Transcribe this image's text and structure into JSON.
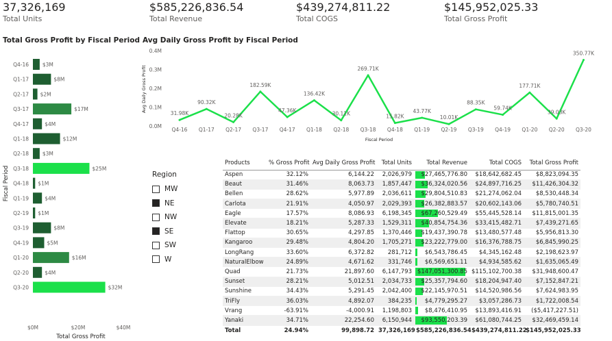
{
  "kpis": [
    {
      "value": "37,326,169",
      "label": "Total Units"
    },
    {
      "value": "$585,226,836.54",
      "label": "Total Revenue"
    },
    {
      "value": "$439,274,811.22",
      "label": "Total COGS"
    },
    {
      "value": "$145,952,025.33",
      "label": "Total Gross Profit"
    }
  ],
  "bar_chart_title": "Total Gross Profit by Fiscal Period",
  "line_chart_title": "Avg Daily Gross Profit by Fiscal Period",
  "colors": {
    "bar_dark": "#1e5e31",
    "bar_mid": "#2d8a44",
    "bar_bright": "#1be04a",
    "line": "#1be04a",
    "checked": "#252423"
  },
  "chart_data": [
    {
      "type": "bar",
      "orientation": "horizontal",
      "categories": [
        "Q4-16",
        "Q1-17",
        "Q2-17",
        "Q3-17",
        "Q4-17",
        "Q1-18",
        "Q2-18",
        "Q3-18",
        "Q4-18",
        "Q1-19",
        "Q2-19",
        "Q3-19",
        "Q4-19",
        "Q1-20",
        "Q2-20",
        "Q3-20"
      ],
      "values": [
        3,
        8,
        2,
        17,
        4,
        12,
        3,
        25,
        1,
        4,
        1,
        8,
        5,
        16,
        4,
        32
      ],
      "data_labels": [
        "$3M",
        "$8M",
        "$2M",
        "$17M",
        "$4M",
        "$12M",
        "$3M",
        "$25M",
        "$1M",
        "$4M",
        "$1M",
        "$8M",
        "$5M",
        "$16M",
        "$4M",
        "$32M"
      ],
      "xlabel": "Total Gross Profit",
      "ylabel": "Fiscal Period",
      "xlim": [
        0,
        40
      ],
      "xticks": [
        "$0M",
        "$20M",
        "$40M"
      ]
    },
    {
      "type": "line",
      "x": [
        "Q4-16",
        "Q1-17",
        "Q2-17",
        "Q3-17",
        "Q4-17",
        "Q1-18",
        "Q2-18",
        "Q3-18",
        "Q4-18",
        "Q1-19",
        "Q2-19",
        "Q3-19",
        "Q4-19",
        "Q1-20",
        "Q2-20",
        "Q3-20"
      ],
      "values": [
        31.98,
        90.32,
        20.28,
        182.59,
        47.36,
        136.42,
        30.11,
        269.71,
        15.82,
        43.77,
        10.01,
        88.35,
        59.74,
        177.71,
        39.03,
        350.77
      ],
      "data_labels": [
        "31.98K",
        "90.32K",
        "20.28K",
        "182.59K",
        "47.36K",
        "136.42K",
        "30.11K",
        "269.71K",
        "15.82K",
        "43.77K",
        "10.01K",
        "88.35K",
        "59.74K",
        "177.71K",
        "39.03K",
        "350.77K"
      ],
      "xlabel": "Fiscal Period",
      "ylabel": "Avg Daily Gross Profit",
      "ylim": [
        0,
        400
      ],
      "yticks": [
        "0.0M",
        "0.1M",
        "0.2M",
        "0.3M",
        "0.4M"
      ]
    }
  ],
  "slicer": {
    "title": "Region",
    "items": [
      {
        "label": "MW",
        "checked": false
      },
      {
        "label": "NE",
        "checked": true
      },
      {
        "label": "NW",
        "checked": false
      },
      {
        "label": "SE",
        "checked": true
      },
      {
        "label": "SW",
        "checked": false
      },
      {
        "label": "W",
        "checked": false
      }
    ]
  },
  "table": {
    "headers": [
      "Products",
      "% Gross Profit",
      "Avg Daily Gross Profit",
      "Total Units",
      "Total Revenue",
      "Total COGS",
      "Total Gross Profit"
    ],
    "rows": [
      {
        "cells": [
          "Aspen",
          "32.12%",
          "6,144.22",
          "2,026,979",
          "$27,465,776.80",
          "$18,642,682.45",
          "$8,823,094.35"
        ],
        "revenue": 27.47
      },
      {
        "cells": [
          "Beaut",
          "31.46%",
          "8,063.73",
          "1,857,447",
          "$36,324,020.56",
          "$24,897,716.25",
          "$11,426,304.32"
        ],
        "revenue": 36.32
      },
      {
        "cells": [
          "Bellen",
          "28.62%",
          "5,977.89",
          "2,036,611",
          "$29,804,510.83",
          "$21,274,062.04",
          "$8,530,448.34"
        ],
        "revenue": 29.8
      },
      {
        "cells": [
          "Carlota",
          "21.91%",
          "4,050.97",
          "2,029,393",
          "$26,382,883.57",
          "$20,602,143.06",
          "$5,780,740.51"
        ],
        "revenue": 26.38
      },
      {
        "cells": [
          "Eagle",
          "17.57%",
          "8,086.93",
          "6,198,345",
          "$67,260,529.49",
          "$55,445,528.14",
          "$11,815,001.35"
        ],
        "revenue": 67.26
      },
      {
        "cells": [
          "Elevate",
          "18.21%",
          "5,287.33",
          "1,529,311",
          "$40,854,754.36",
          "$33,415,482.71",
          "$7,439,271.65"
        ],
        "revenue": 40.85
      },
      {
        "cells": [
          "Flattop",
          "30.65%",
          "4,297.85",
          "1,370,446",
          "$19,437,390.78",
          "$13,480,577.48",
          "$5,956,813.30"
        ],
        "revenue": 19.44
      },
      {
        "cells": [
          "Kangaroo",
          "29.48%",
          "4,804.20",
          "1,705,271",
          "$23,222,779.00",
          "$16,376,788.75",
          "$6,845,990.25"
        ],
        "revenue": 23.22
      },
      {
        "cells": [
          "LongRang",
          "33.60%",
          "6,372.82",
          "281,712",
          "$6,543,786.45",
          "$4,345,162.48",
          "$2,198,623.97"
        ],
        "revenue": 6.54
      },
      {
        "cells": [
          "NaturalElbow",
          "24.89%",
          "4,671.62",
          "331,746",
          "$6,569,651.11",
          "$4,934,585.62",
          "$1,635,065.49"
        ],
        "revenue": 6.57
      },
      {
        "cells": [
          "Quad",
          "21.73%",
          "21,897.60",
          "6,147,793",
          "$147,051,300.85",
          "$115,102,700.38",
          "$31,948,600.47"
        ],
        "revenue": 147.05
      },
      {
        "cells": [
          "Sunset",
          "28.21%",
          "5,012.51",
          "2,034,733",
          "$25,357,794.60",
          "$18,204,947.40",
          "$7,152,847.21"
        ],
        "revenue": 25.36
      },
      {
        "cells": [
          "Sunshine",
          "34.43%",
          "5,291.45",
          "2,042,400",
          "$22,145,970.51",
          "$14,520,986.56",
          "$7,624,983.95"
        ],
        "revenue": 22.15
      },
      {
        "cells": [
          "TriFly",
          "36.03%",
          "4,892.07",
          "384,235",
          "$4,779,295.27",
          "$3,057,286.73",
          "$1,722,008.54"
        ],
        "revenue": 4.78
      },
      {
        "cells": [
          "Vrang",
          "-63.91%",
          "-4,000.91",
          "1,198,803",
          "$8,476,410.95",
          "$13,893,416.91",
          "($5,417,227.51)"
        ],
        "revenue": 8.48
      },
      {
        "cells": [
          "Yanaki",
          "34.71%",
          "22,254.60",
          "6,150,944",
          "$93,550,203.39",
          "$61,080,744.25",
          "$32,469,459.14"
        ],
        "revenue": 93.55
      }
    ],
    "total": [
      "Total",
      "24.94%",
      "99,898.72",
      "37,326,169",
      "$585,226,836.54",
      "$439,274,811.22",
      "$145,952,025.33"
    ]
  }
}
